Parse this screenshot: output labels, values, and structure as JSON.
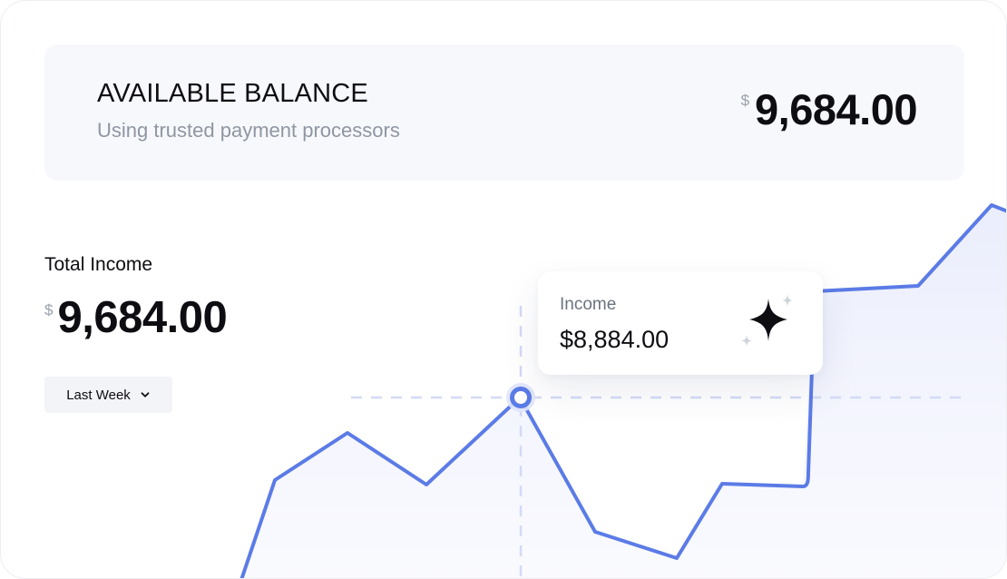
{
  "balance": {
    "title": "AVAILABLE BALANCE",
    "subtitle": "Using trusted payment processors",
    "currency": "$",
    "amount": "9,684.00"
  },
  "income": {
    "label": "Total Income",
    "currency": "$",
    "amount": "9,684.00",
    "period": "Last Week"
  },
  "tooltip": {
    "label": "Income",
    "value": "$8,884.00"
  },
  "colors": {
    "line": "#5b7be6",
    "guide": "#d4dbf7",
    "area": "#eef0fd"
  },
  "icons": {
    "dropdown": "chevron-down-icon",
    "tooltip": "sparkle-icon"
  }
}
